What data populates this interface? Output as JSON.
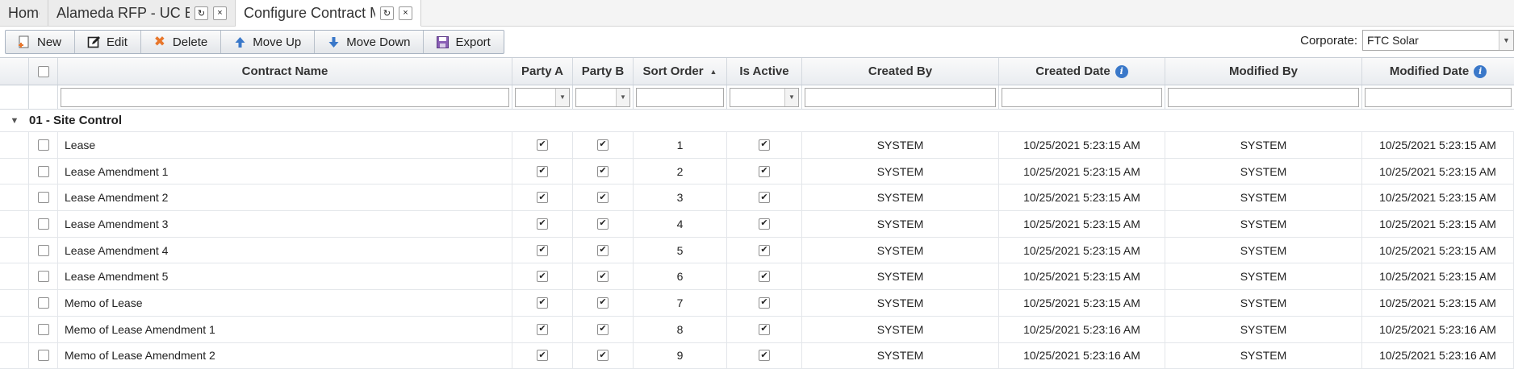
{
  "tabs": [
    {
      "label": "Home"
    },
    {
      "label": "Alameda RFP - UC Ber..."
    },
    {
      "label": "Configure Contract M..."
    }
  ],
  "toolbar": {
    "new_label": "New",
    "edit_label": "Edit",
    "delete_label": "Delete",
    "move_up_label": "Move Up",
    "move_down_label": "Move Down",
    "export_label": "Export"
  },
  "corporate": {
    "label": "Corporate:",
    "value": "FTC Solar"
  },
  "columns": {
    "contract_name": "Contract Name",
    "party_a": "Party A",
    "party_b": "Party B",
    "sort_order": "Sort Order",
    "is_active": "Is Active",
    "created_by": "Created By",
    "created_date": "Created Date",
    "modified_by": "Modified By",
    "modified_date": "Modified Date"
  },
  "group": {
    "label": "01 - Site Control"
  },
  "rows": [
    {
      "name": "Lease",
      "sort": "1",
      "created_by": "SYSTEM",
      "created_date": "10/25/2021 5:23:15 AM",
      "modified_by": "SYSTEM",
      "modified_date": "10/25/2021 5:23:15 AM"
    },
    {
      "name": "Lease Amendment 1",
      "sort": "2",
      "created_by": "SYSTEM",
      "created_date": "10/25/2021 5:23:15 AM",
      "modified_by": "SYSTEM",
      "modified_date": "10/25/2021 5:23:15 AM"
    },
    {
      "name": "Lease Amendment 2",
      "sort": "3",
      "created_by": "SYSTEM",
      "created_date": "10/25/2021 5:23:15 AM",
      "modified_by": "SYSTEM",
      "modified_date": "10/25/2021 5:23:15 AM"
    },
    {
      "name": "Lease Amendment 3",
      "sort": "4",
      "created_by": "SYSTEM",
      "created_date": "10/25/2021 5:23:15 AM",
      "modified_by": "SYSTEM",
      "modified_date": "10/25/2021 5:23:15 AM"
    },
    {
      "name": "Lease Amendment 4",
      "sort": "5",
      "created_by": "SYSTEM",
      "created_date": "10/25/2021 5:23:15 AM",
      "modified_by": "SYSTEM",
      "modified_date": "10/25/2021 5:23:15 AM"
    },
    {
      "name": "Lease Amendment 5",
      "sort": "6",
      "created_by": "SYSTEM",
      "created_date": "10/25/2021 5:23:15 AM",
      "modified_by": "SYSTEM",
      "modified_date": "10/25/2021 5:23:15 AM"
    },
    {
      "name": "Memo of Lease",
      "sort": "7",
      "created_by": "SYSTEM",
      "created_date": "10/25/2021 5:23:15 AM",
      "modified_by": "SYSTEM",
      "modified_date": "10/25/2021 5:23:15 AM"
    },
    {
      "name": "Memo of Lease Amendment 1",
      "sort": "8",
      "created_by": "SYSTEM",
      "created_date": "10/25/2021 5:23:16 AM",
      "modified_by": "SYSTEM",
      "modified_date": "10/25/2021 5:23:16 AM"
    },
    {
      "name": "Memo of Lease Amendment 2",
      "sort": "9",
      "created_by": "SYSTEM",
      "created_date": "10/25/2021 5:23:16 AM",
      "modified_by": "SYSTEM",
      "modified_date": "10/25/2021 5:23:16 AM"
    }
  ],
  "icons": {
    "new": "new-doc-icon",
    "edit": "edit-icon",
    "delete": "delete-x-icon",
    "move_up": "arrow-up-icon",
    "move_down": "arrow-down-icon",
    "export": "export-save-icon",
    "refresh": "refresh-icon",
    "close": "close-icon",
    "info": "info-icon"
  },
  "colors": {
    "accent": "#3a78c9",
    "delete": "#e8762b",
    "new": "#e8762b"
  }
}
